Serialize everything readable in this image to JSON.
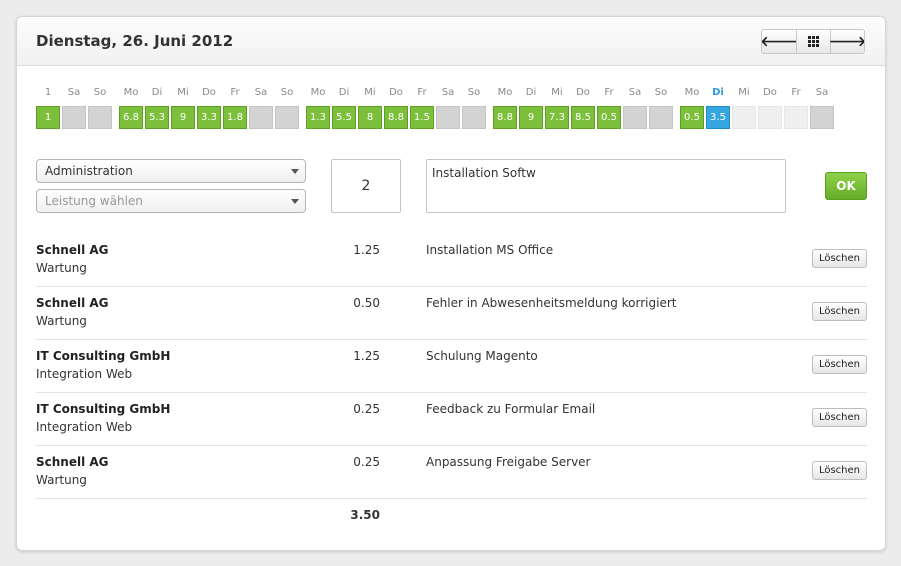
{
  "header": {
    "title": "Dienstag, 26. Juni 2012",
    "nav": {
      "prev_icon": "arrow-left-icon",
      "grid_icon": "grid-icon",
      "next_icon": "arrow-right-icon"
    }
  },
  "calendar": {
    "colors": {
      "filled": "#7bbf3a",
      "today": "#36a6e0",
      "weekend": "#d3d3d3",
      "empty": "#efefef"
    },
    "days": [
      {
        "label": "1",
        "value": "1",
        "status": "filled"
      },
      {
        "label": "Sa",
        "value": "",
        "status": "weekend"
      },
      {
        "label": "So",
        "value": "",
        "status": "weekend"
      },
      {
        "label": "Mo",
        "value": "6.8",
        "status": "filled"
      },
      {
        "label": "Di",
        "value": "5.3",
        "status": "filled"
      },
      {
        "label": "Mi",
        "value": "9",
        "status": "filled"
      },
      {
        "label": "Do",
        "value": "3.3",
        "status": "filled"
      },
      {
        "label": "Fr",
        "value": "1.8",
        "status": "filled"
      },
      {
        "label": "Sa",
        "value": "",
        "status": "weekend"
      },
      {
        "label": "So",
        "value": "",
        "status": "weekend"
      },
      {
        "label": "Mo",
        "value": "1.3",
        "status": "filled"
      },
      {
        "label": "Di",
        "value": "5.5",
        "status": "filled"
      },
      {
        "label": "Mi",
        "value": "8",
        "status": "filled"
      },
      {
        "label": "Do",
        "value": "8.8",
        "status": "filled"
      },
      {
        "label": "Fr",
        "value": "1.5",
        "status": "filled"
      },
      {
        "label": "Sa",
        "value": "",
        "status": "weekend"
      },
      {
        "label": "So",
        "value": "",
        "status": "weekend"
      },
      {
        "label": "Mo",
        "value": "8.8",
        "status": "filled"
      },
      {
        "label": "Di",
        "value": "9",
        "status": "filled"
      },
      {
        "label": "Mi",
        "value": "7.3",
        "status": "filled"
      },
      {
        "label": "Do",
        "value": "8.5",
        "status": "filled"
      },
      {
        "label": "Fr",
        "value": "0.5",
        "status": "filled"
      },
      {
        "label": "Sa",
        "value": "",
        "status": "weekend"
      },
      {
        "label": "So",
        "value": "",
        "status": "weekend"
      },
      {
        "label": "Mo",
        "value": "0.5",
        "status": "filled"
      },
      {
        "label": "Di",
        "value": "3.5",
        "status": "today"
      },
      {
        "label": "Mi",
        "value": "",
        "status": "empty"
      },
      {
        "label": "Do",
        "value": "",
        "status": "empty"
      },
      {
        "label": "Fr",
        "value": "",
        "status": "empty"
      },
      {
        "label": "Sa",
        "value": "",
        "status": "weekend"
      }
    ]
  },
  "form": {
    "project_select": "Administration",
    "service_select_placeholder": "Leistung wählen",
    "quantity": "2",
    "description": "Installation Softw",
    "ok_label": "OK"
  },
  "entries": [
    {
      "company": "Schnell AG",
      "service": "Wartung",
      "hours": "1.25",
      "description": "Installation MS Office",
      "delete_label": "Löschen"
    },
    {
      "company": "Schnell AG",
      "service": "Wartung",
      "hours": "0.50",
      "description": "Fehler in Abwesenheitsmeldung korrigiert",
      "delete_label": "Löschen"
    },
    {
      "company": "IT Consulting GmbH",
      "service": "Integration Web",
      "hours": "1.25",
      "description": "Schulung Magento",
      "delete_label": "Löschen"
    },
    {
      "company": "IT Consulting GmbH",
      "service": "Integration Web",
      "hours": "0.25",
      "description": "Feedback zu Formular Email",
      "delete_label": "Löschen"
    },
    {
      "company": "Schnell AG",
      "service": "Wartung",
      "hours": "0.25",
      "description": "Anpassung Freigabe Server",
      "delete_label": "Löschen"
    }
  ],
  "total_hours": "3.50"
}
